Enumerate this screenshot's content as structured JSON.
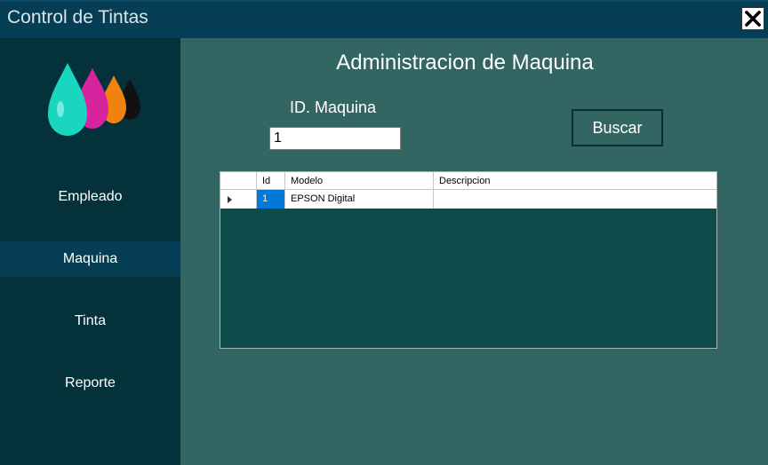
{
  "window": {
    "title": "Control de Tintas"
  },
  "sidebar": {
    "items": [
      {
        "label": "Empleado",
        "active": false
      },
      {
        "label": "Maquina",
        "active": true
      },
      {
        "label": "Tinta",
        "active": false
      },
      {
        "label": "Reporte",
        "active": false
      }
    ]
  },
  "main": {
    "heading": "Administracion de Maquina",
    "id_label": "ID. Maquina",
    "id_value": "1",
    "search_label": "Buscar"
  },
  "grid": {
    "columns": [
      "Id",
      "Modelo",
      "Descripcion"
    ],
    "rows": [
      {
        "id": "1",
        "modelo": "EPSON Digital",
        "descripcion": ""
      }
    ]
  },
  "colors": {
    "titlebar": "#063f55",
    "sidebar": "#05313a",
    "sidebar_active": "#063f55",
    "main": "#336662",
    "grid_background": "#0d4a4a",
    "selection": "#0078d7"
  }
}
